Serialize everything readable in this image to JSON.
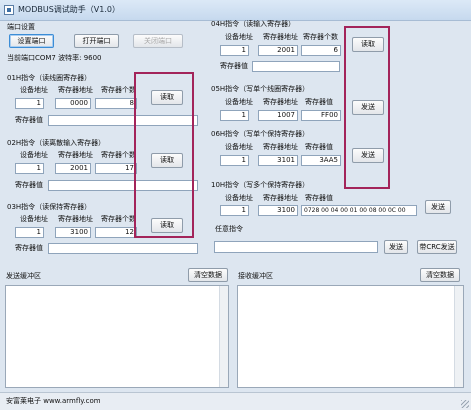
{
  "window": {
    "title": "MODBUS调试助手（V1.0）"
  },
  "port": {
    "group_label": "端口设置",
    "btn_settings": "设置端口",
    "btn_open": "打开端口",
    "btn_close": "关闭端口",
    "status": "当前端口COM7 波特率: 9600"
  },
  "fc01": {
    "title": "01H指令（读线圈寄存器）",
    "h_addr": "设备地址",
    "h_reg": "寄存器地址",
    "h_count": "寄存器个数",
    "addr": "1",
    "reg": "0000",
    "count": "8",
    "btn": "读取",
    "val_label": "寄存器值",
    "val": ""
  },
  "fc02": {
    "title": "02H指令（读离散输入寄存器）",
    "h_addr": "设备地址",
    "h_reg": "寄存器地址",
    "h_count": "寄存器个数",
    "addr": "1",
    "reg": "2001",
    "count": "17",
    "btn": "读取",
    "val_label": "寄存器值",
    "val": ""
  },
  "fc03": {
    "title": "03H指令（读保持寄存器）",
    "h_addr": "设备地址",
    "h_reg": "寄存器地址",
    "h_count": "寄存器个数",
    "addr": "1",
    "reg": "3100",
    "count": "12",
    "btn": "读取",
    "val_label": "寄存器值",
    "val": ""
  },
  "fc04": {
    "title": "04H指令（读输入寄存器）",
    "h_addr": "设备地址",
    "h_reg": "寄存器地址",
    "h_count": "寄存器个数",
    "addr": "1",
    "reg": "2001",
    "count": "6",
    "btn": "读取",
    "val_label": "寄存器值",
    "val": ""
  },
  "fc05": {
    "title": "05H指令（写单个线圈寄存器）",
    "h_addr": "设备地址",
    "h_reg": "寄存器地址",
    "h_val": "寄存器值",
    "addr": "1",
    "reg": "1007",
    "val": "FF00",
    "btn": "发送"
  },
  "fc06": {
    "title": "06H指令（写单个保持寄存器）",
    "h_addr": "设备地址",
    "h_reg": "寄存器地址",
    "h_val": "寄存器值",
    "addr": "1",
    "reg": "3101",
    "val": "3AA5",
    "btn": "发送"
  },
  "fc10": {
    "title": "10H指令（写多个保持寄存器）",
    "h_addr": "设备地址",
    "h_reg": "寄存器地址",
    "h_val": "寄存器值",
    "addr": "1",
    "reg": "3100",
    "val": "0728 00 04 00 01 00 08 00 0C 00",
    "btn": "发送"
  },
  "custom": {
    "label": "任意指令",
    "value": "",
    "btn_send": "发送",
    "btn_crc": "带CRC发送"
  },
  "send_area": {
    "label": "发送缓冲区",
    "btn_clear": "清空数据",
    "content": ""
  },
  "recv_area": {
    "label": "接收缓冲区",
    "btn_clear": "清空数据",
    "content": ""
  },
  "status_bar": {
    "text": "安富莱电子 www.armfly.com"
  },
  "colors": {
    "highlight": "#a3245a",
    "background": "#dde6f0"
  },
  "icons": {
    "app": "app-icon",
    "minimize": "minimize-icon",
    "maximize": "maximize-icon",
    "close": "close-icon"
  }
}
